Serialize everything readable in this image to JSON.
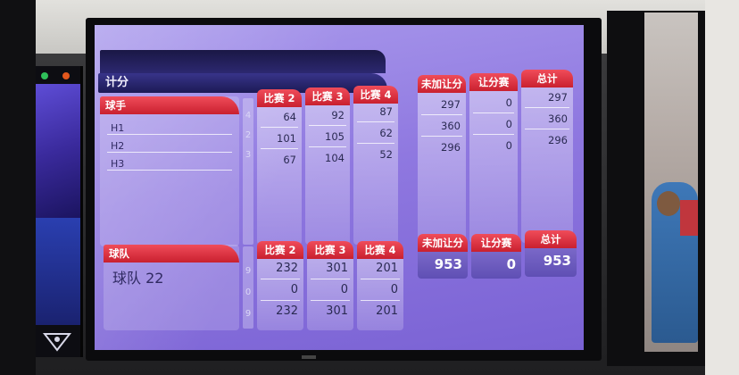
{
  "screen_title": "计分",
  "players_panel": {
    "header": "球手",
    "players": [
      "H1",
      "H2",
      "H3"
    ],
    "row_numbers": [
      "4",
      "2",
      "3"
    ],
    "games": [
      {
        "label": "比赛 2",
        "scores": [
          "64",
          "101",
          "67"
        ]
      },
      {
        "label": "比赛 3",
        "scores": [
          "92",
          "105",
          "104"
        ]
      },
      {
        "label": "比赛 4",
        "scores": [
          "87",
          "62",
          "52"
        ]
      }
    ],
    "totals": [
      {
        "label": "未加让分",
        "values": [
          "297",
          "360",
          "296"
        ]
      },
      {
        "label": "让分赛",
        "values": [
          "0",
          "0",
          "0"
        ]
      },
      {
        "label": "总计",
        "values": [
          "297",
          "360",
          "296"
        ]
      }
    ]
  },
  "team_panel": {
    "header": "球队",
    "team_name": "球队 22",
    "row_numbers": [
      "9",
      "0",
      "9"
    ],
    "games": [
      {
        "label": "比赛 2",
        "values": [
          "232",
          "0",
          "232"
        ]
      },
      {
        "label": "比赛 3",
        "values": [
          "301",
          "0",
          "301"
        ]
      },
      {
        "label": "比赛 4",
        "values": [
          "201",
          "0",
          "201"
        ]
      }
    ],
    "totals": [
      {
        "label": "未加让分",
        "value": "953"
      },
      {
        "label": "让分赛",
        "value": "0"
      },
      {
        "label": "总计",
        "value": "953"
      }
    ]
  },
  "colors": {
    "screen_bg": "#8f78e0",
    "header_red": "#d52a39",
    "title_bar": "#25226a"
  }
}
